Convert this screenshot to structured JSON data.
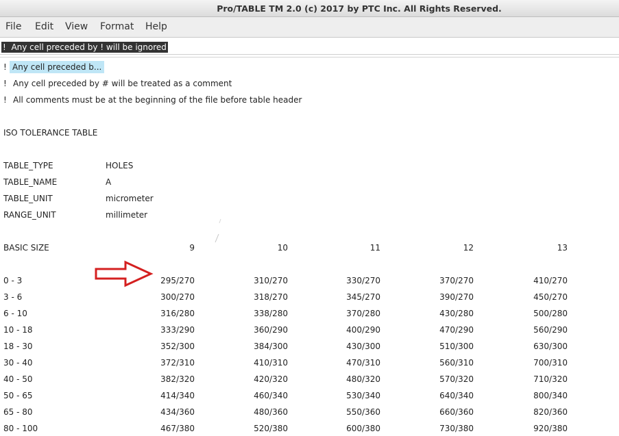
{
  "window": {
    "title": "Pro/TABLE  TM  2.0  (c) 2017 by PTC Inc.  All Rights Reserved."
  },
  "menu": {
    "items": [
      {
        "label": "File"
      },
      {
        "label": "Edit"
      },
      {
        "label": "View"
      },
      {
        "label": "Format"
      },
      {
        "label": "Help"
      }
    ]
  },
  "edit_field": {
    "value": "!  Any cell preceded by ! will be ignored"
  },
  "comments": [
    {
      "mark": "!",
      "text": "Any cell preceded b..."
    },
    {
      "mark": "!",
      "text": "Any cell preceded by # will be treated as a comment"
    },
    {
      "mark": "!",
      "text": "All comments must be at the beginning of the file before table header"
    }
  ],
  "table_title": "ISO TOLERANCE TABLE",
  "properties": [
    {
      "key": "TABLE_TYPE",
      "value": "HOLES"
    },
    {
      "key": "TABLE_NAME",
      "value": "A"
    },
    {
      "key": "TABLE_UNIT",
      "value": "micrometer"
    },
    {
      "key": "RANGE_UNIT",
      "value": "millimeter"
    }
  ],
  "header": {
    "label": "BASIC SIZE",
    "columns": [
      "9",
      "10",
      "11",
      "12",
      "13"
    ]
  },
  "rows": [
    {
      "range": "0 - 3",
      "values": [
        "295/270",
        "310/270",
        "330/270",
        "370/270",
        "410/270"
      ]
    },
    {
      "range": "3 - 6",
      "values": [
        "300/270",
        "318/270",
        "345/270",
        "390/270",
        "450/270"
      ]
    },
    {
      "range": "6 - 10",
      "values": [
        "316/280",
        "338/280",
        "370/280",
        "430/280",
        "500/280"
      ]
    },
    {
      "range": "10 - 18",
      "values": [
        "333/290",
        "360/290",
        "400/290",
        "470/290",
        "560/290"
      ]
    },
    {
      "range": "18 - 30",
      "values": [
        "352/300",
        "384/300",
        "430/300",
        "510/300",
        "630/300"
      ]
    },
    {
      "range": "30 - 40",
      "values": [
        "372/310",
        "410/310",
        "470/310",
        "560/310",
        "700/310"
      ]
    },
    {
      "range": "40 - 50",
      "values": [
        "382/320",
        "420/320",
        "480/320",
        "570/320",
        "710/320"
      ]
    },
    {
      "range": "50 - 65",
      "values": [
        "414/340",
        "460/340",
        "530/340",
        "640/340",
        "800/340"
      ]
    },
    {
      "range": "65 - 80",
      "values": [
        "434/360",
        "480/360",
        "550/360",
        "660/360",
        "820/360"
      ]
    },
    {
      "range": "80 - 100",
      "values": [
        "467/380",
        "520/380",
        "600/380",
        "730/380",
        "920/380"
      ]
    }
  ],
  "colors": {
    "selection": "#bfe6f6",
    "arrow": "#d42020",
    "edit_highlight": "#333333"
  },
  "icons": {
    "annotation": "red-right-arrow-icon"
  }
}
